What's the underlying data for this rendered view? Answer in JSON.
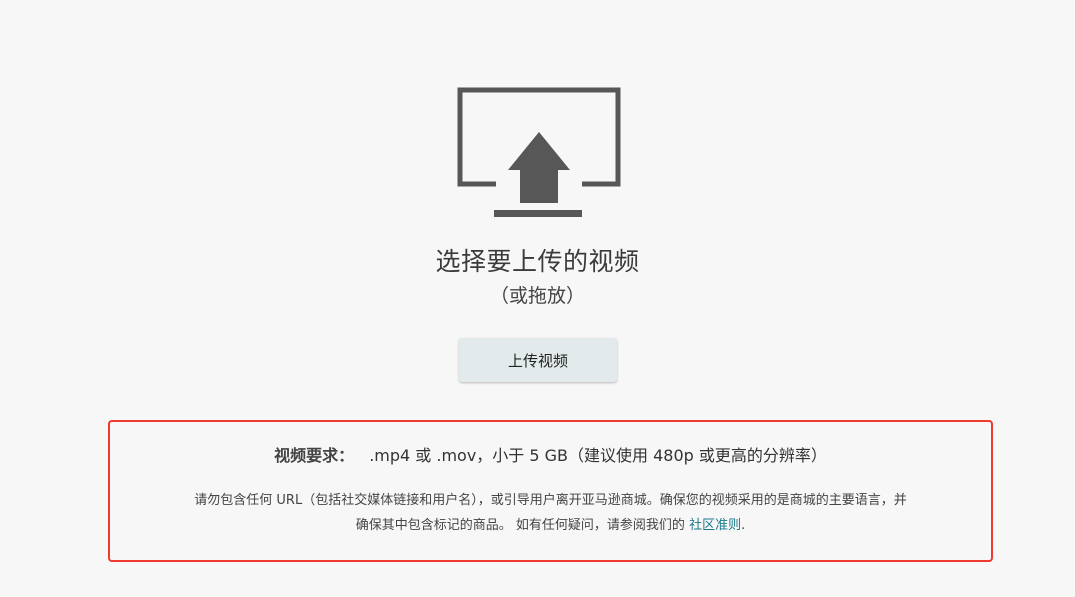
{
  "upload": {
    "icon": "upload-to-monitor-icon",
    "title": "选择要上传的视频",
    "subtitle": "（或拖放）",
    "button_label": "上传视频"
  },
  "requirements": {
    "label": "视频要求：",
    "formats": ".mp4 或 .mov，小于 5 GB（建议使用 480p 或更高的分辨率）",
    "guideline_line1": "请勿包含任何 URL（包括社交媒体链接和用户名），或引导用户离开亚马逊商城。确保您的视频采用的是商城的主要语言，并",
    "guideline_line2": "确保其中包含标记的商品。 如有任何疑问，请参阅我们的",
    "guideline_link": "社区准则",
    "guideline_end": "."
  },
  "colors": {
    "icon": "#575757",
    "button_bg": "#e3eaec",
    "highlight_border": "#f03a2e",
    "link": "#1a7a8a"
  }
}
